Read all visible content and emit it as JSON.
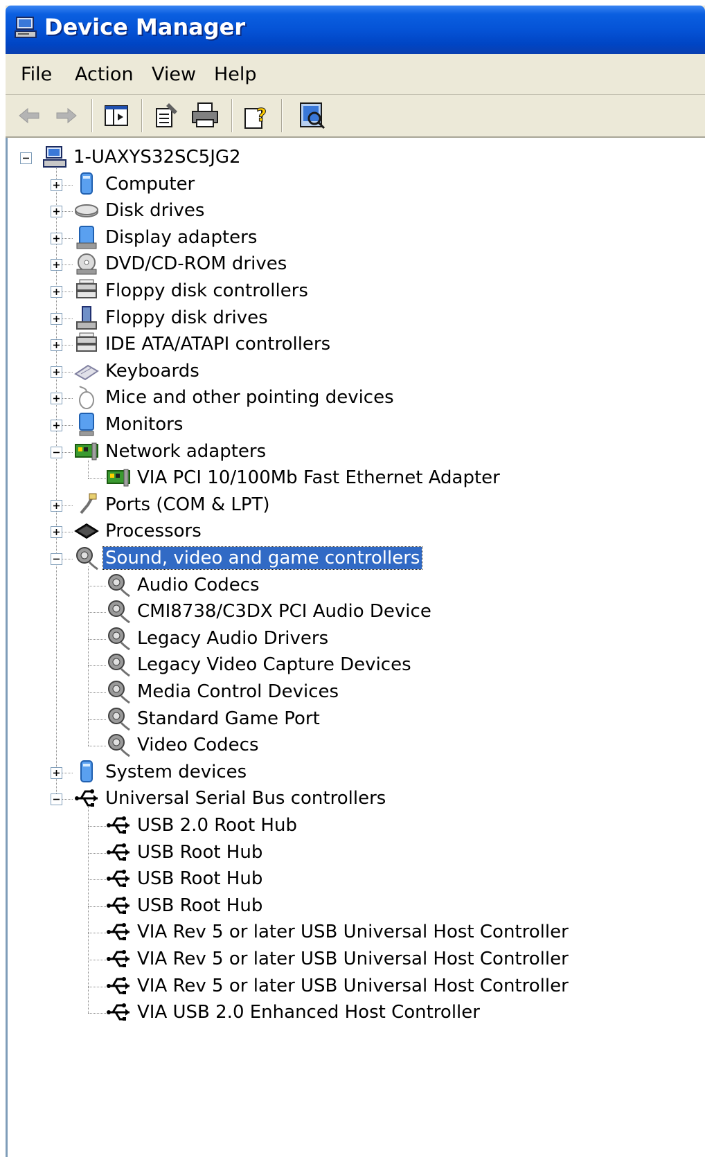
{
  "window": {
    "title": "Device Manager"
  },
  "menu": [
    "File",
    "Action",
    "View",
    "Help"
  ],
  "toolbar": {
    "buttons": [
      "back-icon",
      "forward-icon",
      "show-hide-console-tree-icon",
      "properties-icon",
      "print-icon",
      "help-icon",
      "scan-hardware-icon"
    ]
  },
  "tree": {
    "root": "1-UAXYS32SC5JG2",
    "nodes": [
      {
        "label": "Computer",
        "icon": "computer-icon",
        "expanded": false
      },
      {
        "label": "Disk drives",
        "icon": "disk-drive-icon",
        "expanded": false
      },
      {
        "label": "Display adapters",
        "icon": "display-adapter-icon",
        "expanded": false
      },
      {
        "label": "DVD/CD-ROM drives",
        "icon": "cdrom-icon",
        "expanded": false
      },
      {
        "label": "Floppy disk controllers",
        "icon": "controller-icon",
        "expanded": false
      },
      {
        "label": "Floppy disk drives",
        "icon": "floppy-icon",
        "expanded": false
      },
      {
        "label": "IDE ATA/ATAPI controllers",
        "icon": "controller-icon",
        "expanded": false
      },
      {
        "label": "Keyboards",
        "icon": "keyboard-icon",
        "expanded": false
      },
      {
        "label": "Mice and other pointing devices",
        "icon": "mouse-icon",
        "expanded": false
      },
      {
        "label": "Monitors",
        "icon": "monitor-icon",
        "expanded": false
      },
      {
        "label": "Network adapters",
        "icon": "network-card-icon",
        "expanded": true,
        "children": [
          "VIA PCI 10/100Mb Fast Ethernet Adapter"
        ]
      },
      {
        "label": "Ports (COM & LPT)",
        "icon": "port-icon",
        "expanded": false
      },
      {
        "label": "Processors",
        "icon": "processor-icon",
        "expanded": false
      },
      {
        "label": "Sound, video and game controllers",
        "icon": "sound-icon",
        "expanded": true,
        "selected": true,
        "children": [
          "Audio Codecs",
          "CMI8738/C3DX PCI Audio Device",
          "Legacy Audio Drivers",
          "Legacy Video Capture Devices",
          "Media Control Devices",
          "Standard Game Port",
          "Video Codecs"
        ]
      },
      {
        "label": "System devices",
        "icon": "system-devices-icon",
        "expanded": false
      },
      {
        "label": "Universal Serial Bus controllers",
        "icon": "usb-icon",
        "expanded": true,
        "children": [
          "USB 2.0 Root Hub",
          "USB Root Hub",
          "USB Root Hub",
          "USB Root Hub",
          "VIA Rev 5 or later USB Universal Host Controller",
          "VIA Rev 5 or later USB Universal Host Controller",
          "VIA Rev 5 or later USB Universal Host Controller",
          "VIA USB 2.0 Enhanced Host Controller"
        ]
      }
    ]
  },
  "colors": {
    "titlebar": "#0553d6",
    "selection": "#316ac5",
    "chrome": "#ece9d8"
  }
}
